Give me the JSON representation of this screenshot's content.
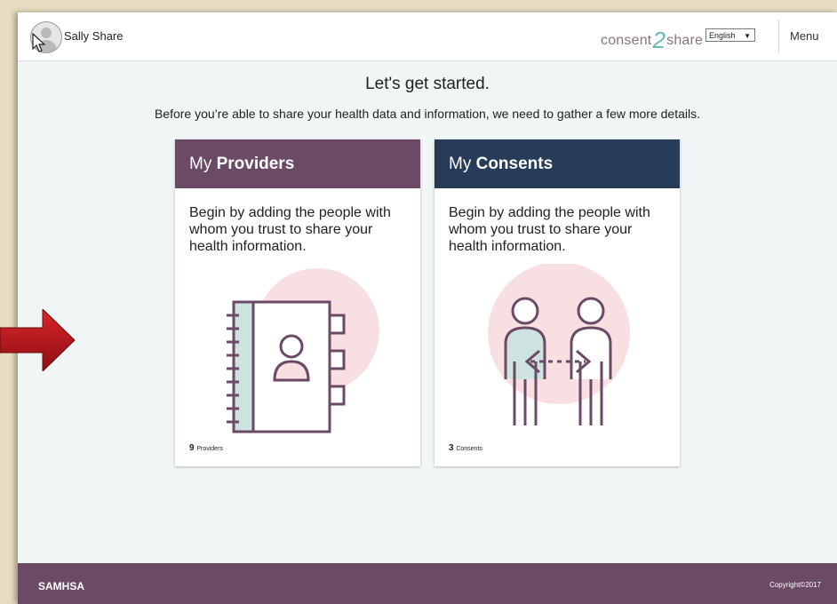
{
  "header": {
    "user_name": "Sally Share",
    "logo": {
      "left": "consent",
      "mid": "2",
      "right": "share"
    },
    "language": "English",
    "menu_label": "Menu"
  },
  "main": {
    "title": "Let's get started.",
    "subtitle": "Before you’re able to share your health data and information, we need to gather a few more details."
  },
  "cards": [
    {
      "head_prefix": "My ",
      "head_bold": "Providers",
      "text": "Begin by adding the people with whom you trust to share your health information.",
      "count": "9",
      "count_unit": "Providers"
    },
    {
      "head_prefix": "My ",
      "head_bold": "Consents",
      "text": "Begin by adding the people with whom you trust to share your health information.",
      "count": "3",
      "count_unit": "Consents"
    }
  ],
  "footer": {
    "left": "SAMHSA",
    "right": "Copyright©2017"
  },
  "colors": {
    "providers_header": "#6b4a66",
    "consents_header": "#263c58",
    "footer": "#6b4a66",
    "illustration_circle": "#f8dfe2",
    "illustration_teal": "#cde3df",
    "illustration_stroke": "#6b4a66",
    "annotation_arrow": "#b3141a"
  }
}
